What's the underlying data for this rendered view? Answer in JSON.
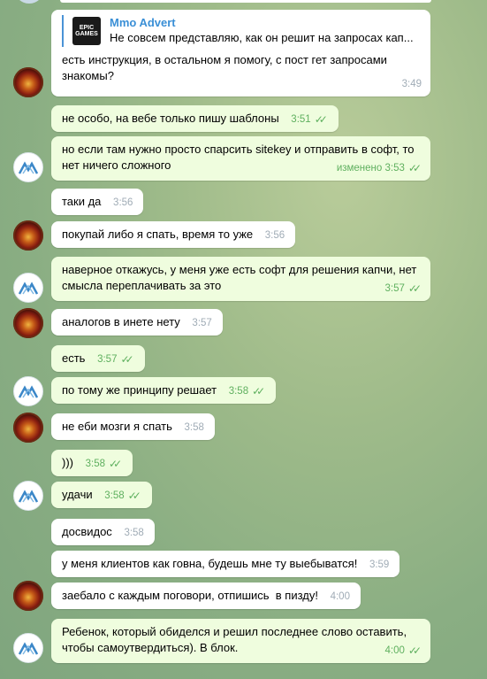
{
  "reply": {
    "name": "Mmo Advert",
    "text": "Не совсем представляю, как он решит на запросах кап...",
    "thumb": "EPIC GAMES"
  },
  "messages": [
    {
      "text": "есть инструкция, в остальном я помогу, с пост гет запросами знакомы?",
      "time": "3:49"
    },
    {
      "text": "не особо, на вебе только пишу шаблоны",
      "time": "3:51"
    },
    {
      "text": "но если там нужно просто спарсить sitekey и отправить в софт, то нет ничего сложного",
      "time": "изменено 3:53"
    },
    {
      "text": "таки да",
      "time": "3:56"
    },
    {
      "text": "покупай либо я спать, время то уже",
      "time": "3:56"
    },
    {
      "text": "наверное откажусь, у меня уже есть софт для решения капчи, нет смысла переплачивать за это",
      "time": "3:57"
    },
    {
      "text": "аналогов в инете нету",
      "time": "3:57"
    },
    {
      "text": "есть",
      "time": "3:57"
    },
    {
      "text": "по тому же принципу решает",
      "time": "3:58"
    },
    {
      "text": "не еби мозги я спать",
      "time": "3:58"
    },
    {
      "text": ")))",
      "time": "3:58"
    },
    {
      "text": "удачи",
      "time": "3:58"
    },
    {
      "text": "досвидос",
      "time": "3:58"
    },
    {
      "text": "у меня клиентов как говна, будешь мне ту выебыватся!",
      "time": "3:59"
    },
    {
      "text": "заебало с каждым поговори, отпишись  в пизду!",
      "time": "4:00"
    },
    {
      "text": "Ребенок, который обиделся и решил последнее слово оставить, чтобы самоутвердиться). В блок.",
      "time": "4:00"
    }
  ],
  "colors": {
    "incoming": "#ffffff",
    "outgoing": "#effdde",
    "accent": "#3a8fd6",
    "checks": "#5fb05f"
  }
}
